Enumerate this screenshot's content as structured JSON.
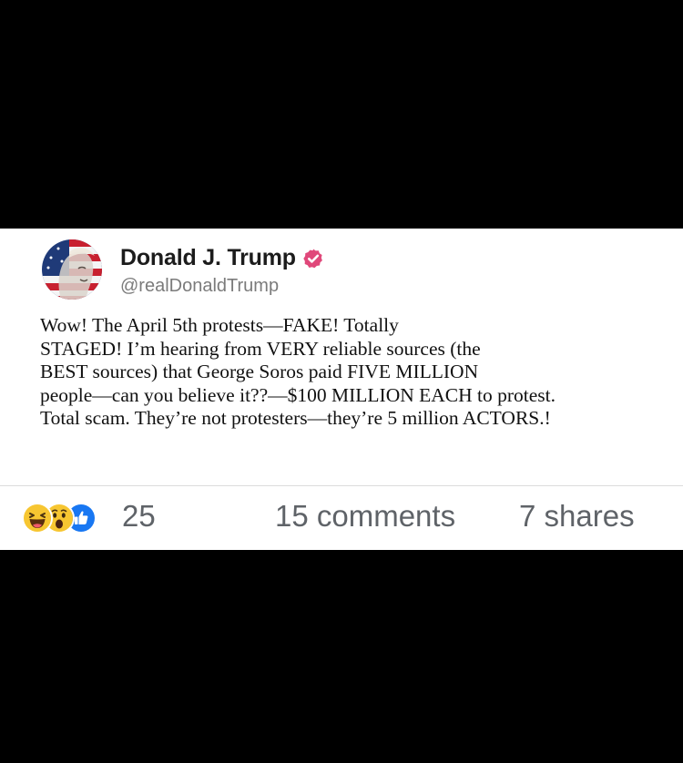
{
  "post": {
    "author_name": "Donald J. Trump",
    "author_handle": "@realDonaldTrump",
    "verified_badge_icon": "verified-check-icon",
    "verified_color": "#e0487a",
    "text_lines": [
      "Wow! The April 5th protests—FAKE! Totally",
      "STAGED! I’m hearing from VERY reliable sources (the",
      "BEST sources) that George Soros paid FIVE MILLION",
      "people—can you believe it??—$100 MILLION EACH to protest.",
      "Total scam. They’re not protesters—they’re 5 million ACTORS.!"
    ]
  },
  "engagement": {
    "reaction_icons": [
      "haha-reaction-icon",
      "wow-reaction-icon",
      "like-reaction-icon"
    ],
    "reaction_count": "25",
    "comments": "15 comments",
    "shares": "7 shares"
  },
  "colors": {
    "background": "#000000",
    "card": "#ffffff",
    "like_blue": "#1877f2",
    "emoji_yellow": "#f7c631"
  }
}
